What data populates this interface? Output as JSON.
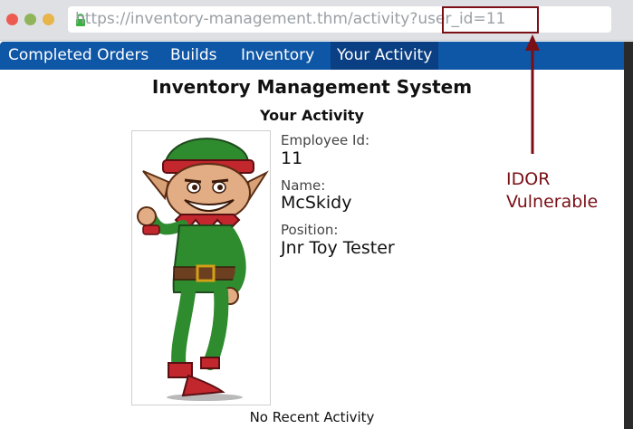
{
  "browser": {
    "url": "https://inventory-management.thm/activity?user_id=11"
  },
  "nav": {
    "items": [
      {
        "label": "Completed Orders"
      },
      {
        "label": "Builds"
      },
      {
        "label": "Inventory"
      },
      {
        "label": "Your Activity",
        "active": true
      }
    ]
  },
  "page": {
    "title": "Inventory Management System",
    "section": "Your Activity"
  },
  "profile": {
    "employee_id_label": "Employee Id:",
    "employee_id": "11",
    "name_label": "Name:",
    "name": "McSkidy",
    "position_label": "Position:",
    "position": "Jnr Toy Tester"
  },
  "activity": {
    "empty_text": "No Recent Activity"
  },
  "annotation": {
    "line1": "IDOR",
    "line2": "Vulnerable",
    "color": "#7b0f16"
  },
  "colors": {
    "navbar": "#0e56a6",
    "navbar_active": "#0a3f83"
  }
}
